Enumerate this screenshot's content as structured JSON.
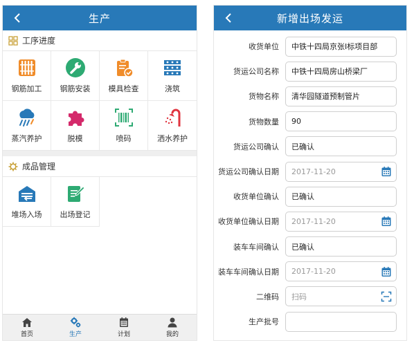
{
  "left": {
    "title": "生产",
    "progress": {
      "title": "工序进度",
      "items": [
        {
          "label": "钢筋加工",
          "icon": "rebar-processing-icon"
        },
        {
          "label": "钢筋安装",
          "icon": "wrench-icon"
        },
        {
          "label": "模具检查",
          "icon": "clipboard-check-icon"
        },
        {
          "label": "浇筑",
          "icon": "pouring-icon"
        },
        {
          "label": "蒸汽养护",
          "icon": "steam-curing-icon"
        },
        {
          "label": "脱模",
          "icon": "puzzle-icon"
        },
        {
          "label": "喷码",
          "icon": "barcode-icon"
        },
        {
          "label": "洒水养护",
          "icon": "shower-icon"
        }
      ]
    },
    "products": {
      "title": "成品管理",
      "items": [
        {
          "label": "堆场入场",
          "icon": "warehouse-in-icon"
        },
        {
          "label": "出场登记",
          "icon": "register-edit-icon"
        }
      ]
    },
    "tabs": [
      {
        "label": "首页",
        "icon": "home-icon"
      },
      {
        "label": "生产",
        "icon": "gears-icon"
      },
      {
        "label": "计划",
        "icon": "calendar-icon"
      },
      {
        "label": "我的",
        "icon": "user-icon"
      }
    ]
  },
  "right": {
    "title": "新增出场发运",
    "fields": [
      {
        "label": "收货单位",
        "value": "中铁十四局京张Ⅰ标项目部",
        "placeholder": ""
      },
      {
        "label": "货运公司名称",
        "value": "中铁十四局房山桥梁厂",
        "placeholder": ""
      },
      {
        "label": "货物名称",
        "value": "清华园隧道预制管片",
        "placeholder": ""
      },
      {
        "label": "货物数量",
        "value": "90",
        "placeholder": ""
      },
      {
        "label": "货运公司确认",
        "value": "已确认",
        "placeholder": ""
      },
      {
        "label": "货运公司确认日期",
        "value": "",
        "placeholder": "2017-11-20"
      },
      {
        "label": "收货单位确认",
        "value": "已确认",
        "placeholder": ""
      },
      {
        "label": "收货单位确认日期",
        "value": "",
        "placeholder": "2017-11-20"
      },
      {
        "label": "装车车间确认",
        "value": "已确认",
        "placeholder": ""
      },
      {
        "label": "装车车间确认日期",
        "value": "",
        "placeholder": "2017-11-20"
      },
      {
        "label": "二维码",
        "value": "",
        "placeholder": "扫码"
      },
      {
        "label": "生产批号",
        "value": "",
        "placeholder": ""
      }
    ]
  },
  "colors": {
    "primary": "#2879b8",
    "gold": "#c9a23a",
    "orange": "#f08c2a",
    "red": "#e0343f",
    "green": "#2eaa73",
    "teal": "#27a8a0"
  }
}
